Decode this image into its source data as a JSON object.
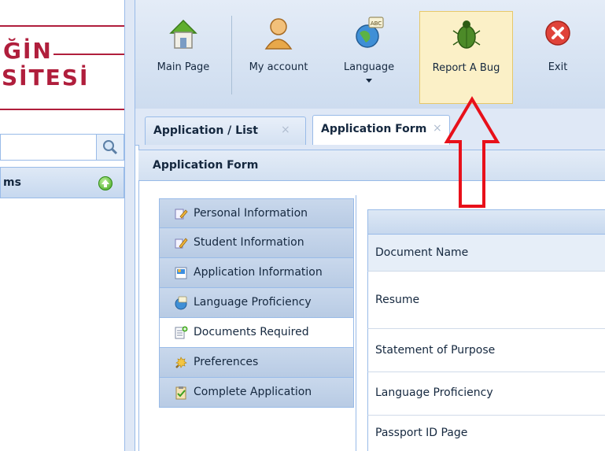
{
  "logo": {
    "line1": "ĞİN",
    "line2": "SİTESİ"
  },
  "sidebar": {
    "search_placeholder": "",
    "menu_label": "ms"
  },
  "toolbar": {
    "items": [
      {
        "label": "Main Page",
        "icon": "home-icon"
      },
      {
        "label": "My account",
        "icon": "user-icon"
      },
      {
        "label": "Language",
        "icon": "globe-icon"
      },
      {
        "label": "Report A Bug",
        "icon": "bug-icon"
      },
      {
        "label": "Exit",
        "icon": "exit-icon"
      }
    ]
  },
  "tabs": [
    {
      "label": "Application / List",
      "close": "×"
    },
    {
      "label": "Application Form",
      "close": "×"
    }
  ],
  "panel": {
    "title": "Application Form"
  },
  "nav": [
    {
      "label": "Personal Information",
      "icon": "personal-info-icon"
    },
    {
      "label": "Student Information",
      "icon": "student-info-icon"
    },
    {
      "label": "Application Information",
      "icon": "application-info-icon"
    },
    {
      "label": "Language Proficiency",
      "icon": "language-icon"
    },
    {
      "label": "Documents Required",
      "icon": "documents-icon"
    },
    {
      "label": "Preferences",
      "icon": "preferences-icon"
    },
    {
      "label": "Complete Application",
      "icon": "complete-icon"
    }
  ],
  "table": {
    "column": "Document Name",
    "rows": [
      "Resume",
      "Statement of Purpose",
      "Language Proficiency",
      "Passport ID Page"
    ]
  },
  "colors": {
    "accent": "#99bbe8",
    "annotation": "#e8101a",
    "logo": "#b01e3c"
  }
}
